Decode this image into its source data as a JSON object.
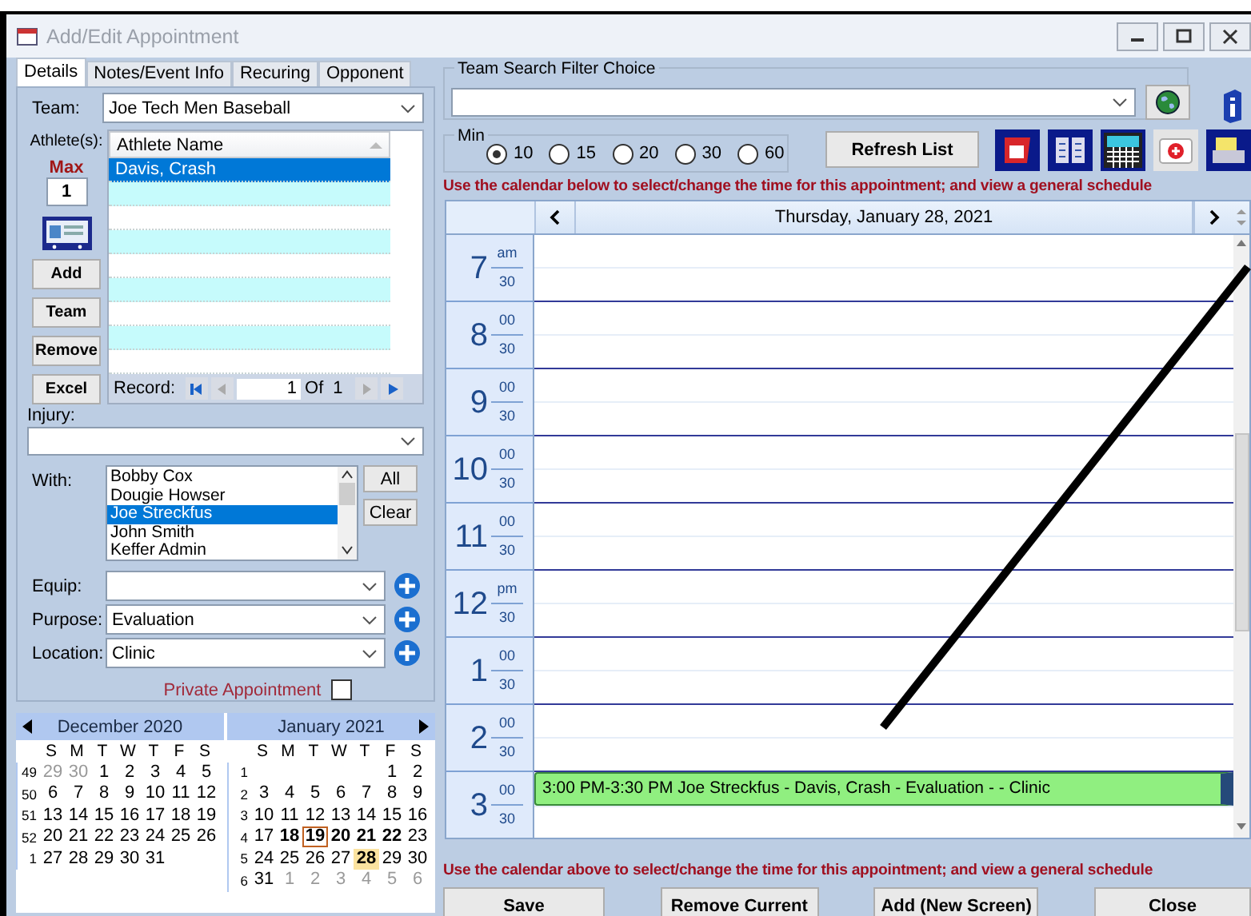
{
  "window": {
    "title": "Add/Edit Appointment"
  },
  "tabs": [
    {
      "label": "Details",
      "selected": true
    },
    {
      "label": "Notes/Event Info",
      "selected": false
    },
    {
      "label": "Recuring",
      "selected": false
    },
    {
      "label": "Opponent",
      "selected": false
    }
  ],
  "details": {
    "team": {
      "label": "Team:",
      "value": "Joe Tech Men Baseball"
    },
    "athletes": {
      "label": "Athlete(s):",
      "max_label": "Max",
      "max_value": "1",
      "buttons": [
        "Add",
        "Team",
        "Remove",
        "Excel"
      ],
      "column": "Athlete Name",
      "rows": [
        {
          "name": "Davis, Crash",
          "selected": true
        }
      ],
      "record": {
        "label": "Record:",
        "current": "1",
        "of": "Of",
        "total": "1"
      }
    },
    "injury": {
      "label": "Injury:"
    },
    "with": {
      "label": "With:",
      "buttons": [
        "All",
        "Clear"
      ],
      "items": [
        {
          "name": "Bobby Cox",
          "selected": false
        },
        {
          "name": "Dougie Howser",
          "selected": false
        },
        {
          "name": "Joe Streckfus",
          "selected": true
        },
        {
          "name": "John Smith",
          "selected": false
        },
        {
          "name": "Keffer Admin",
          "selected": false
        }
      ]
    },
    "fields": [
      {
        "label": "Equip:"
      },
      {
        "label": "Purpose:",
        "value": "Evaluation"
      },
      {
        "label": "Location:",
        "value": "Clinic"
      }
    ],
    "private": {
      "label": "Private Appointment",
      "checked": false
    }
  },
  "mini_calendar": [
    {
      "title": "December 2020",
      "weekdays": [
        "S",
        "M",
        "T",
        "W",
        "T",
        "F",
        "S"
      ],
      "weeks": [
        {
          "week": "49",
          "days": [
            {
              "d": "29",
              "kind": "other"
            },
            {
              "d": "30",
              "kind": "other"
            },
            {
              "d": "1",
              "kind": "plain"
            },
            {
              "d": "2",
              "kind": "plain"
            },
            {
              "d": "3",
              "kind": "plain"
            },
            {
              "d": "4",
              "kind": "plain"
            },
            {
              "d": "5",
              "kind": "plain"
            }
          ]
        },
        {
          "week": "50",
          "days": [
            {
              "d": "6",
              "kind": "plain"
            },
            {
              "d": "7",
              "kind": "plain"
            },
            {
              "d": "8",
              "kind": "plain"
            },
            {
              "d": "9",
              "kind": "plain"
            },
            {
              "d": "10",
              "kind": "plain"
            },
            {
              "d": "11",
              "kind": "plain"
            },
            {
              "d": "12",
              "kind": "plain"
            }
          ]
        },
        {
          "week": "51",
          "days": [
            {
              "d": "13",
              "kind": "plain"
            },
            {
              "d": "14",
              "kind": "plain"
            },
            {
              "d": "15",
              "kind": "plain"
            },
            {
              "d": "16",
              "kind": "plain"
            },
            {
              "d": "17",
              "kind": "plain"
            },
            {
              "d": "18",
              "kind": "plain"
            },
            {
              "d": "19",
              "kind": "plain"
            }
          ]
        },
        {
          "week": "52",
          "days": [
            {
              "d": "20",
              "kind": "plain"
            },
            {
              "d": "21",
              "kind": "plain"
            },
            {
              "d": "22",
              "kind": "plain"
            },
            {
              "d": "23",
              "kind": "plain"
            },
            {
              "d": "24",
              "kind": "plain"
            },
            {
              "d": "25",
              "kind": "plain"
            },
            {
              "d": "26",
              "kind": "plain"
            }
          ]
        },
        {
          "week": "1",
          "days": [
            {
              "d": "27",
              "kind": "plain"
            },
            {
              "d": "28",
              "kind": "plain"
            },
            {
              "d": "29",
              "kind": "plain"
            },
            {
              "d": "30",
              "kind": "plain"
            },
            {
              "d": "31",
              "kind": "plain"
            }
          ]
        }
      ]
    },
    {
      "title": "January 2021",
      "weekdays": [
        "S",
        "M",
        "T",
        "W",
        "T",
        "F",
        "S"
      ],
      "weeks": [
        {
          "week": "1",
          "days": [
            {
              "kind": "blank"
            },
            {
              "kind": "blank"
            },
            {
              "kind": "blank"
            },
            {
              "kind": "blank"
            },
            {
              "kind": "blank"
            },
            {
              "d": "1",
              "kind": "plain"
            },
            {
              "d": "2",
              "kind": "plain"
            }
          ]
        },
        {
          "week": "2",
          "days": [
            {
              "d": "3",
              "kind": "plain"
            },
            {
              "d": "4",
              "kind": "plain"
            },
            {
              "d": "5",
              "kind": "plain"
            },
            {
              "d": "6",
              "kind": "plain"
            },
            {
              "d": "7",
              "kind": "plain"
            },
            {
              "d": "8",
              "kind": "plain"
            },
            {
              "d": "9",
              "kind": "plain"
            }
          ]
        },
        {
          "week": "3",
          "days": [
            {
              "d": "10",
              "kind": "plain"
            },
            {
              "d": "11",
              "kind": "plain"
            },
            {
              "d": "12",
              "kind": "plain"
            },
            {
              "d": "13",
              "kind": "plain"
            },
            {
              "d": "14",
              "kind": "plain"
            },
            {
              "d": "15",
              "kind": "plain"
            },
            {
              "d": "16",
              "kind": "plain"
            }
          ]
        },
        {
          "week": "4",
          "days": [
            {
              "d": "17",
              "kind": "plain"
            },
            {
              "d": "18",
              "kind": "bold"
            },
            {
              "d": "19",
              "kind": "today"
            },
            {
              "d": "20",
              "kind": "bold"
            },
            {
              "d": "21",
              "kind": "bold"
            },
            {
              "d": "22",
              "kind": "bold"
            },
            {
              "d": "23",
              "kind": "plain"
            }
          ]
        },
        {
          "week": "5",
          "days": [
            {
              "d": "24",
              "kind": "plain"
            },
            {
              "d": "25",
              "kind": "plain"
            },
            {
              "d": "26",
              "kind": "plain"
            },
            {
              "d": "27",
              "kind": "plain"
            },
            {
              "d": "28",
              "kind": "selected"
            },
            {
              "d": "29",
              "kind": "plain"
            },
            {
              "d": "30",
              "kind": "plain"
            }
          ]
        },
        {
          "week": "6",
          "days": [
            {
              "d": "31",
              "kind": "plain"
            },
            {
              "d": "1",
              "kind": "other"
            },
            {
              "d": "2",
              "kind": "other"
            },
            {
              "d": "3",
              "kind": "other"
            },
            {
              "d": "4",
              "kind": "other"
            },
            {
              "d": "5",
              "kind": "other"
            },
            {
              "d": "6",
              "kind": "other"
            }
          ]
        }
      ]
    }
  ],
  "team_filter": {
    "legend": "Team Search Filter Choice"
  },
  "minutes": {
    "legend": "Min",
    "options": [
      {
        "label": "10",
        "selected": true
      },
      {
        "label": "15",
        "selected": false
      },
      {
        "label": "20",
        "selected": false
      },
      {
        "label": "30",
        "selected": false
      },
      {
        "label": "60",
        "selected": false
      }
    ]
  },
  "refresh_button": "Refresh List",
  "hint_top": "Use the calendar below to select/change the time for this appointment; and view a general schedule",
  "day_view": {
    "date": "Thursday, January 28, 2021",
    "hours": [
      {
        "hour": "7",
        "upper": "am",
        "lower": "30"
      },
      {
        "hour": "8",
        "upper": "00",
        "lower": "30"
      },
      {
        "hour": "9",
        "upper": "00",
        "lower": "30"
      },
      {
        "hour": "10",
        "upper": "00",
        "lower": "30"
      },
      {
        "hour": "11",
        "upper": "00",
        "lower": "30"
      },
      {
        "hour": "12",
        "upper": "pm",
        "lower": "30"
      },
      {
        "hour": "1",
        "upper": "00",
        "lower": "30"
      },
      {
        "hour": "2",
        "upper": "00",
        "lower": "30"
      },
      {
        "hour": "3",
        "upper": "00",
        "lower": "30",
        "appointment": "3:00 PM-3:30 PM Joe Streckfus - Davis, Crash  - Evaluation -  - Clinic"
      }
    ]
  },
  "hint_bottom": "Use the calendar above to select/change the time for this appointment; and view a general schedule",
  "buttons": [
    "Save",
    "Remove Current",
    "Add (New Screen)",
    "Close"
  ]
}
